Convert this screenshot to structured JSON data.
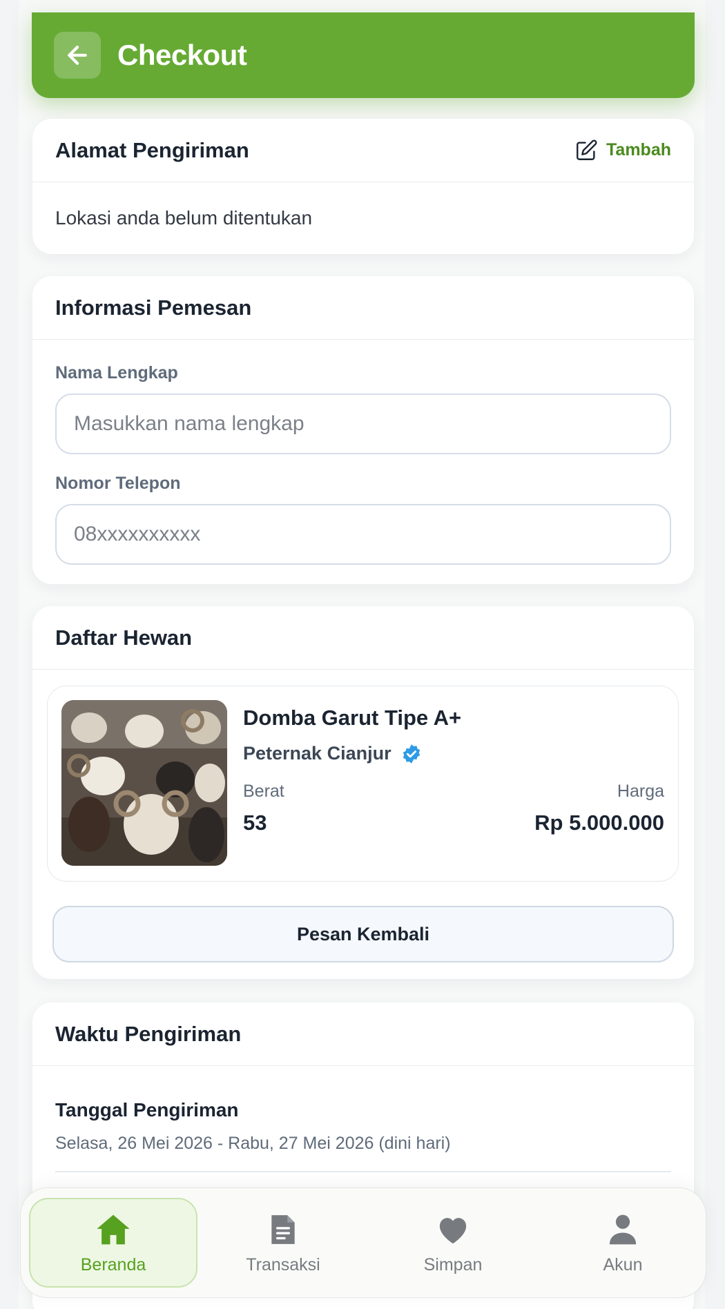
{
  "header": {
    "title": "Checkout"
  },
  "address": {
    "title": "Alamat Pengiriman",
    "add_label": "Tambah",
    "empty_text": "Lokasi anda belum ditentukan"
  },
  "customer": {
    "title": "Informasi Pemesan",
    "name_label": "Nama Lengkap",
    "name_placeholder": "Masukkan nama lengkap",
    "phone_label": "Nomor Telepon",
    "phone_placeholder": "08xxxxxxxxxx"
  },
  "animals": {
    "title": "Daftar Hewan",
    "items": [
      {
        "name": "Domba Garut Tipe A+",
        "seller": "Peternak Cianjur",
        "weight_label": "Berat",
        "weight": "53",
        "price_label": "Harga",
        "price": "Rp 5.000.000"
      }
    ],
    "reorder_label": "Pesan Kembali"
  },
  "delivery": {
    "title": "Waktu Pengiriman",
    "date_title": "Tanggal Pengiriman",
    "date_text": "Selasa, 26 Mei 2026 - Rabu, 27 Mei 2026 (dini hari)"
  },
  "nav": {
    "items": [
      {
        "label": "Beranda",
        "icon": "home-icon",
        "active": true
      },
      {
        "label": "Transaksi",
        "icon": "receipt-icon",
        "active": false
      },
      {
        "label": "Simpan",
        "icon": "heart-icon",
        "active": false
      },
      {
        "label": "Akun",
        "icon": "user-icon",
        "active": false
      }
    ]
  },
  "colors": {
    "primary": "#66aa34",
    "active_nav": "#56a11f",
    "verified": "#2f9be6"
  }
}
